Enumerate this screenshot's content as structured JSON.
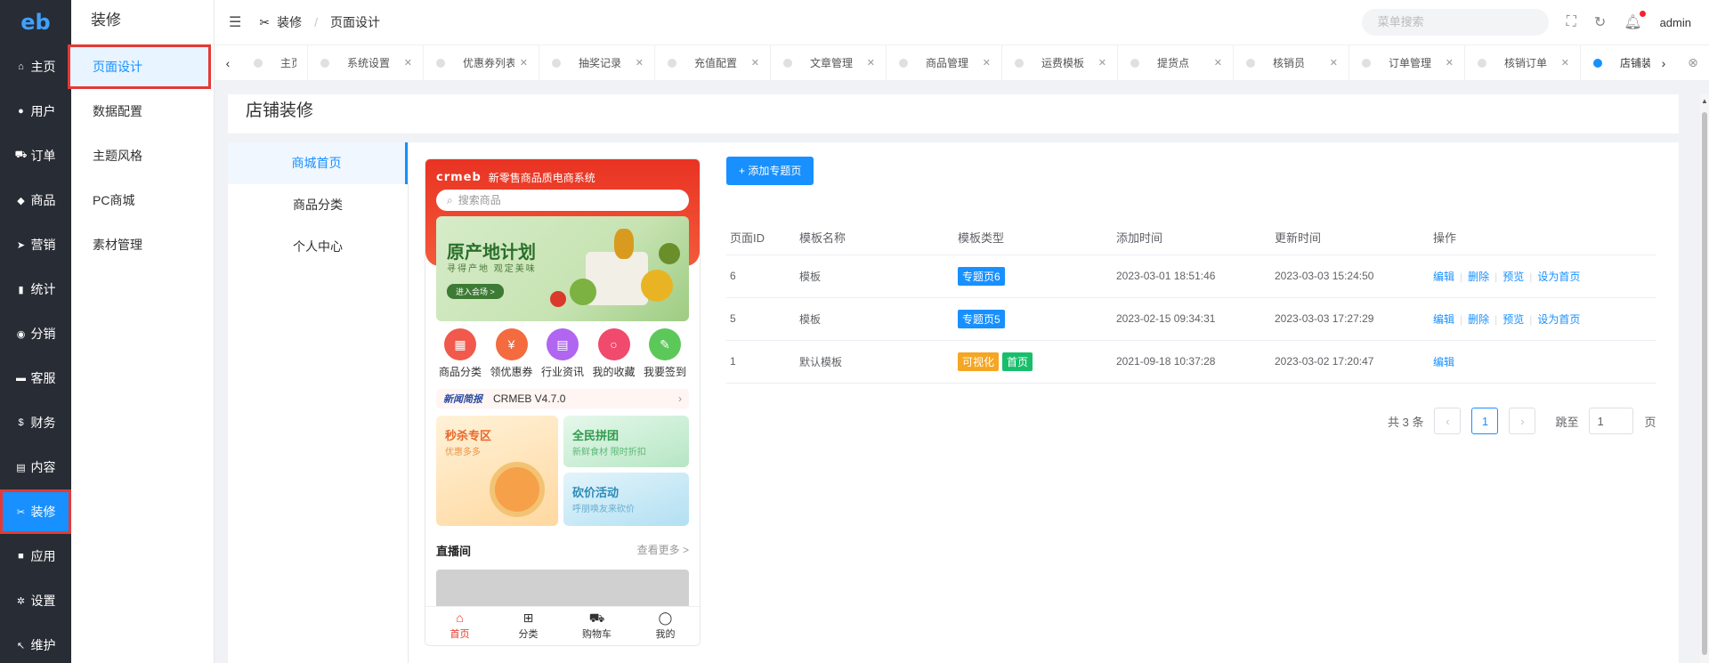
{
  "sidebar": {
    "logo": "eb",
    "items": [
      {
        "label": "主页",
        "icon": "home-icon",
        "glyph": "⌂"
      },
      {
        "label": "用户",
        "icon": "user-icon",
        "glyph": "●"
      },
      {
        "label": "订单",
        "icon": "cart-icon",
        "glyph": "⛟"
      },
      {
        "label": "商品",
        "icon": "product-icon",
        "glyph": "◆"
      },
      {
        "label": "营销",
        "icon": "send-icon",
        "glyph": "➤"
      },
      {
        "label": "统计",
        "icon": "chart-icon",
        "glyph": "▮"
      },
      {
        "label": "分销",
        "icon": "group-icon",
        "glyph": "◉"
      },
      {
        "label": "客服",
        "icon": "chat-icon",
        "glyph": "▬"
      },
      {
        "label": "财务",
        "icon": "dollar-icon",
        "glyph": "$"
      },
      {
        "label": "内容",
        "icon": "book-icon",
        "glyph": "▤"
      },
      {
        "label": "装修",
        "icon": "tools-icon",
        "glyph": "✂"
      },
      {
        "label": "应用",
        "icon": "cube-icon",
        "glyph": "■"
      },
      {
        "label": "设置",
        "icon": "gear-icon",
        "glyph": "✲"
      },
      {
        "label": "维护",
        "icon": "wrench-icon",
        "glyph": "↖"
      }
    ]
  },
  "submenu": {
    "title": "装修",
    "items": [
      "页面设计",
      "数据配置",
      "主题风格",
      "PC商城",
      "素材管理"
    ]
  },
  "header": {
    "breadcrumb_root": "装修",
    "breadcrumb_current": "页面设计",
    "search_placeholder": "菜单搜索",
    "user": "admin"
  },
  "tabs": [
    "主页",
    "系统设置",
    "优惠券列表",
    "抽奖记录",
    "充值配置",
    "文章管理",
    "商品管理",
    "运费模板",
    "提货点",
    "核销员",
    "订单管理",
    "核销订单",
    "店铺装修"
  ],
  "page": {
    "title": "店铺装修",
    "categories": [
      "商城首页",
      "商品分类",
      "个人中心"
    ]
  },
  "phone": {
    "brand": "crmeb",
    "brand_text": "新零售商品质电商系统",
    "search": "搜索商品",
    "banner_title": "原产地计划",
    "banner_sub": "寻得产地 观定美味",
    "banner_btn": "进入会场 >",
    "icons": [
      {
        "label": "商品分类",
        "color": "#f0594b",
        "glyph": "▦"
      },
      {
        "label": "领优惠券",
        "color": "#f36b3f",
        "glyph": "¥"
      },
      {
        "label": "行业资讯",
        "color": "#b066f0",
        "glyph": "▤"
      },
      {
        "label": "我的收藏",
        "color": "#f04a6c",
        "glyph": "○"
      },
      {
        "label": "我要签到",
        "color": "#5cc85a",
        "glyph": "✎"
      }
    ],
    "news_tag": "新闻简报",
    "news_text": "CRMEB V4.7.0",
    "promo": [
      {
        "title": "秒杀专区",
        "sub": "优惠多多"
      },
      {
        "title": "全民拼团",
        "sub": "新鲜食材 限时折扣"
      },
      {
        "title": "砍价活动",
        "sub": "呼朋唤友来砍价"
      }
    ],
    "live_title": "直播间",
    "live_more": "查看更多 >",
    "nav": [
      "首页",
      "分类",
      "购物车",
      "我的"
    ]
  },
  "table": {
    "add_button": "+ 添加专题页",
    "headers": [
      "页面ID",
      "模板名称",
      "模板类型",
      "添加时间",
      "更新时间",
      "操作"
    ],
    "rows": [
      {
        "id": "6",
        "name": "模板",
        "badges": [
          {
            "text": "专题页6",
            "color": "#1890ff"
          }
        ],
        "added": "2023-03-01 18:51:46",
        "updated": "2023-03-03 15:24:50",
        "ops": [
          "编辑",
          "删除",
          "预览",
          "设为首页"
        ]
      },
      {
        "id": "5",
        "name": "模板",
        "badges": [
          {
            "text": "专题页5",
            "color": "#1890ff"
          }
        ],
        "added": "2023-02-15 09:34:31",
        "updated": "2023-03-03 17:27:29",
        "ops": [
          "编辑",
          "删除",
          "预览",
          "设为首页"
        ]
      },
      {
        "id": "1",
        "name": "默认模板",
        "badges": [
          {
            "text": "可视化",
            "color": "#f5a623"
          },
          {
            "text": "首页",
            "color": "#19be6b"
          }
        ],
        "added": "2021-09-18 10:37:28",
        "updated": "2023-03-02 17:20:47",
        "ops": [
          "编辑"
        ]
      }
    ]
  },
  "pagination": {
    "total": "共 3 条",
    "current": "1",
    "jump_label": "跳至",
    "jump_value": "1",
    "page_unit": "页"
  }
}
